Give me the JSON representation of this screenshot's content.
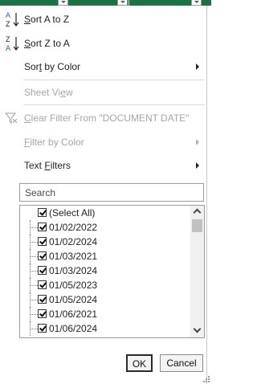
{
  "menu": {
    "sort_az": "Sort A to Z",
    "sort_za": "Sort Z to A",
    "sort_by_color": "Sort by Color",
    "sheet_view": "Sheet View",
    "clear_filter": "Clear Filter From \"DOCUMENT DATE\"",
    "filter_by_color": "Filter by Color",
    "text_filters": "Text Filters"
  },
  "icons": {
    "sort_az": "sort-ascending-icon",
    "sort_za": "sort-descending-icon",
    "clear_filter": "clear-filter-icon",
    "submenu_arrow": "chevron-right-icon"
  },
  "search": {
    "placeholder": "Search"
  },
  "list": {
    "items": [
      {
        "label": "(Select All)",
        "checked": true
      },
      {
        "label": "01/02/2022",
        "checked": true
      },
      {
        "label": "01/02/2024",
        "checked": true
      },
      {
        "label": "01/03/2021",
        "checked": true
      },
      {
        "label": "01/03/2024",
        "checked": true
      },
      {
        "label": "01/05/2023",
        "checked": true
      },
      {
        "label": "01/05/2024",
        "checked": true
      },
      {
        "label": "01/06/2021",
        "checked": true
      },
      {
        "label": "01/06/2024",
        "checked": true
      }
    ]
  },
  "buttons": {
    "ok": "OK",
    "cancel": "Cancel"
  },
  "colors": {
    "sheet_header": "#1e7145",
    "disabled_text": "#a6a6a6",
    "sort_icon_blue": "#1f5fa8"
  }
}
